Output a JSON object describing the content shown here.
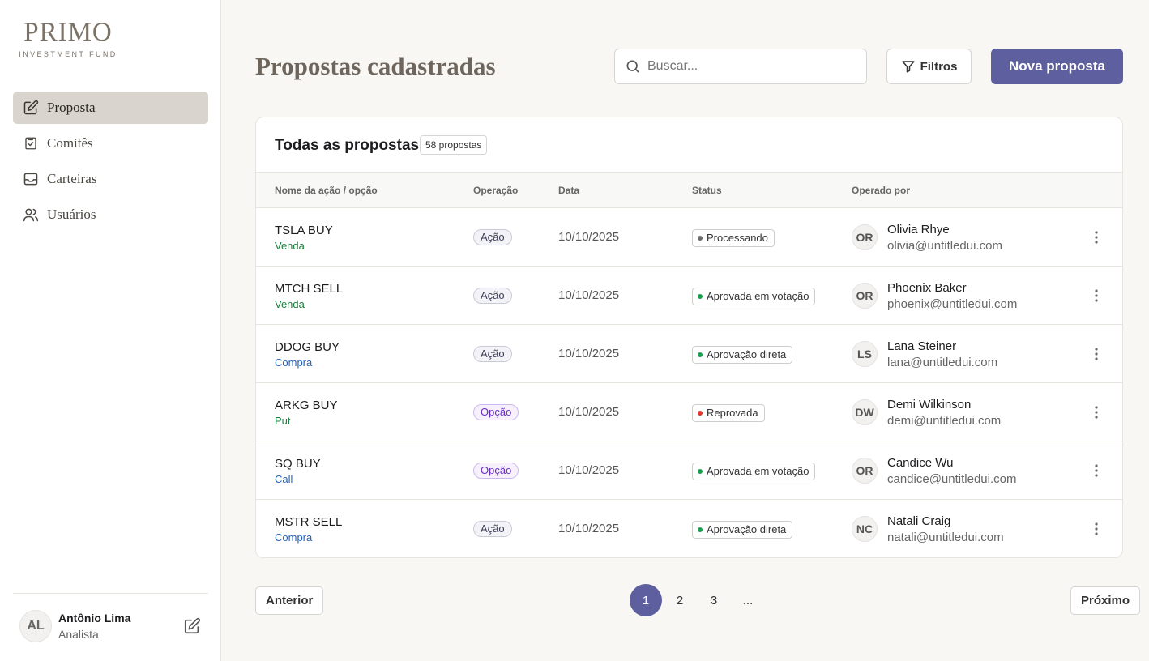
{
  "brand": {
    "name": "PRIMO",
    "tagline": "INVESTMENT FUND"
  },
  "sidebar": {
    "items": [
      {
        "label": "Proposta",
        "icon": "edit-icon",
        "active": true
      },
      {
        "label": "Comitês",
        "icon": "clipboard-check-icon",
        "active": false
      },
      {
        "label": "Carteiras",
        "icon": "inbox-icon",
        "active": false
      },
      {
        "label": "Usuários",
        "icon": "users-icon",
        "active": false
      }
    ],
    "user": {
      "initials": "AL",
      "name": "Antônio Lima",
      "role": "Analista"
    }
  },
  "header": {
    "title": "Propostas cadastradas",
    "search_placeholder": "Buscar...",
    "filter_label": "Filtros",
    "new_label": "Nova proposta"
  },
  "table": {
    "title": "Todas as propostas",
    "count": "58 propostas",
    "columns": [
      "Nome da ação / opção",
      "Operação",
      "Data",
      "Status",
      "Operado por"
    ],
    "rows": [
      {
        "asset": "TSLA BUY",
        "side": "Venda",
        "side_color": "green",
        "operation": "Ação",
        "op_type": "acao",
        "date": "10/10/2025",
        "status": "Processando",
        "status_color": "#6b6b6b",
        "initials": "OR",
        "name": "Olivia Rhye",
        "email": "olivia@untitledui.com"
      },
      {
        "asset": "MTCH SELL",
        "side": "Venda",
        "side_color": "green",
        "operation": "Ação",
        "op_type": "acao",
        "date": "10/10/2025",
        "status": "Aprovada em votação",
        "status_color": "#17a34a",
        "initials": "OR",
        "name": "Phoenix Baker",
        "email": "phoenix@untitledui.com"
      },
      {
        "asset": "DDOG BUY",
        "side": "Compra",
        "side_color": "blue",
        "operation": "Ação",
        "op_type": "acao",
        "date": "10/10/2025",
        "status": "Aprovação direta",
        "status_color": "#17a34a",
        "initials": "LS",
        "name": "Lana Steiner",
        "email": "lana@untitledui.com"
      },
      {
        "asset": "ARKG BUY",
        "side": "Put",
        "side_color": "green",
        "operation": "Opção",
        "op_type": "opcao",
        "date": "10/10/2025",
        "status": "Reprovada",
        "status_color": "#e0342c",
        "initials": "DW",
        "name": "Demi Wilkinson",
        "email": "demi@untitledui.com"
      },
      {
        "asset": "SQ BUY",
        "side": "Call",
        "side_color": "blue",
        "operation": "Opção",
        "op_type": "opcao",
        "date": "10/10/2025",
        "status": "Aprovada em votação",
        "status_color": "#17a34a",
        "initials": "OR",
        "name": "Candice Wu",
        "email": "candice@untitledui.com"
      },
      {
        "asset": "MSTR SELL",
        "side": "Compra",
        "side_color": "blue",
        "operation": "Ação",
        "op_type": "acao",
        "date": "10/10/2025",
        "status": "Aprovação direta",
        "status_color": "#17a34a",
        "initials": "NC",
        "name": "Natali Craig",
        "email": "natali@untitledui.com"
      }
    ]
  },
  "pagination": {
    "prev_label": "Anterior",
    "next_label": "Próximo",
    "pages": [
      "1",
      "2",
      "3",
      "..."
    ],
    "current": "1"
  },
  "colors": {
    "accent": "#5e5f9e",
    "active_nav": "#d9d5ce",
    "brand": "#7b7268"
  }
}
